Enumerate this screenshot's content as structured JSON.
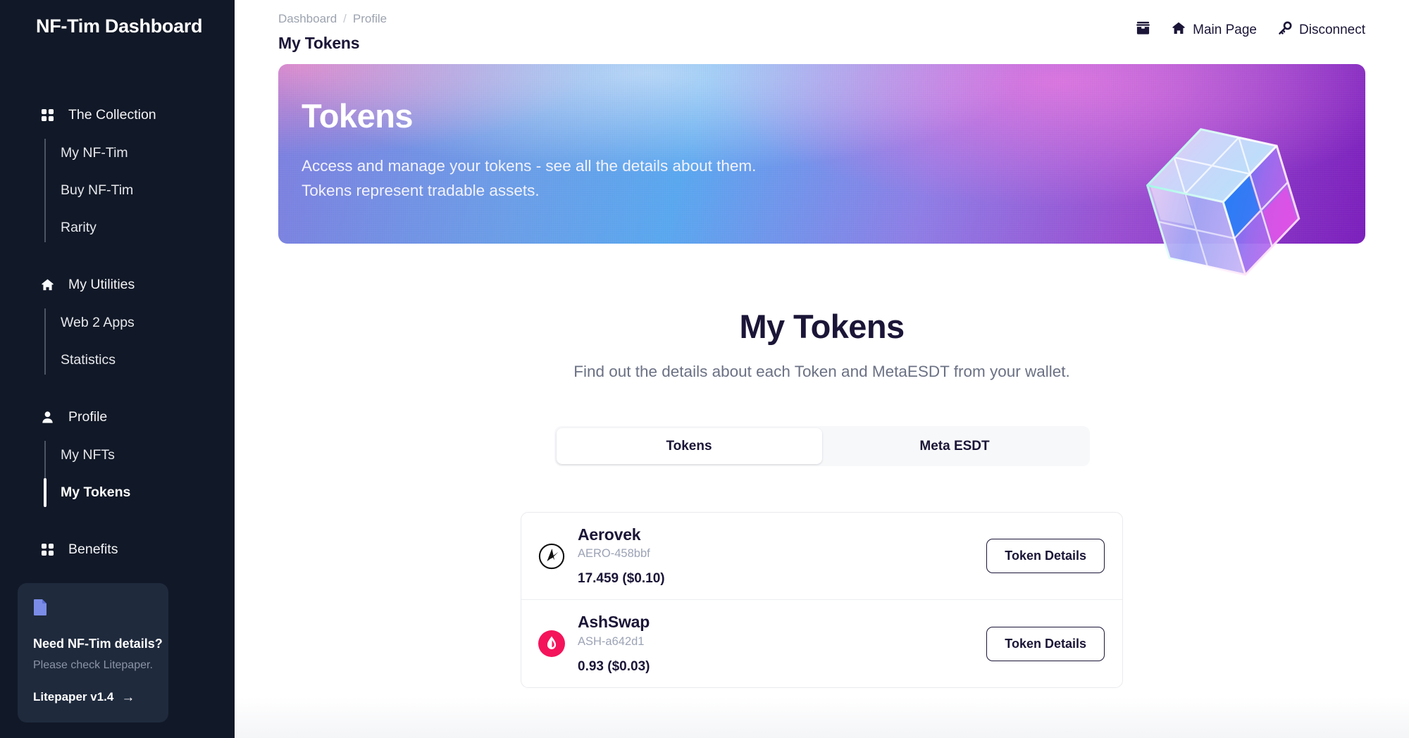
{
  "sidebar": {
    "brand": "NF-Tim Dashboard",
    "groups": [
      {
        "icon": "grid-icon",
        "label": "The Collection",
        "items": [
          {
            "label": "My NF-Tim",
            "active": false
          },
          {
            "label": "Buy NF-Tim",
            "active": false
          },
          {
            "label": "Rarity",
            "active": false
          }
        ]
      },
      {
        "icon": "home-icon",
        "label": "My Utilities",
        "items": [
          {
            "label": "Web 2 Apps",
            "active": false
          },
          {
            "label": "Statistics",
            "active": false
          }
        ]
      },
      {
        "icon": "user-icon",
        "label": "Profile",
        "items": [
          {
            "label": "My NFTs",
            "active": false
          },
          {
            "label": "My Tokens",
            "active": true
          }
        ]
      },
      {
        "icon": "grid-icon",
        "label": "Benefits",
        "items": []
      }
    ],
    "litepaper": {
      "icon": "document-icon",
      "title": "Need NF-Tim details?",
      "subtitle": "Please check Litepaper.",
      "link_label": "Litepaper v1.4",
      "arrow": "→"
    }
  },
  "header": {
    "breadcrumb": {
      "root": "Dashboard",
      "separator": "/",
      "current": "Profile"
    },
    "page_title": "My Tokens",
    "actions": [
      {
        "icon": "wallet-icon",
        "label": ""
      },
      {
        "icon": "home-icon",
        "label": "Main Page"
      },
      {
        "icon": "key-icon",
        "label": "Disconnect"
      }
    ]
  },
  "hero": {
    "title": "Tokens",
    "line1": "Access and manage your tokens - see all the details about them.",
    "line2": "Tokens represent tradable assets.",
    "graphic": "prismatic-cube"
  },
  "main": {
    "heading": "My Tokens",
    "subheading": "Find out the details about each Token and MetaESDT from your wallet.",
    "tabs": [
      {
        "label": "Tokens",
        "active": true
      },
      {
        "label": "Meta ESDT",
        "active": false
      }
    ],
    "tokens": [
      {
        "name": "Aerovek",
        "identifier": "AERO-458bbf",
        "amount": "17.459 ($0.10)",
        "logo": "aerovek-logo-icon",
        "button": "Token Details"
      },
      {
        "name": "AshSwap",
        "identifier": "ASH-a642d1",
        "amount": "0.93 ($0.03)",
        "logo": "ashswap-logo-icon",
        "button": "Token Details"
      }
    ]
  },
  "colors": {
    "sidebar_bg": "#111827",
    "litepaper_bg": "#1f2a3d",
    "text_dark": "#1b1537",
    "muted": "#9ca3b5",
    "accent_pink": "#f4145b",
    "tab_track": "#f7f8fa"
  }
}
